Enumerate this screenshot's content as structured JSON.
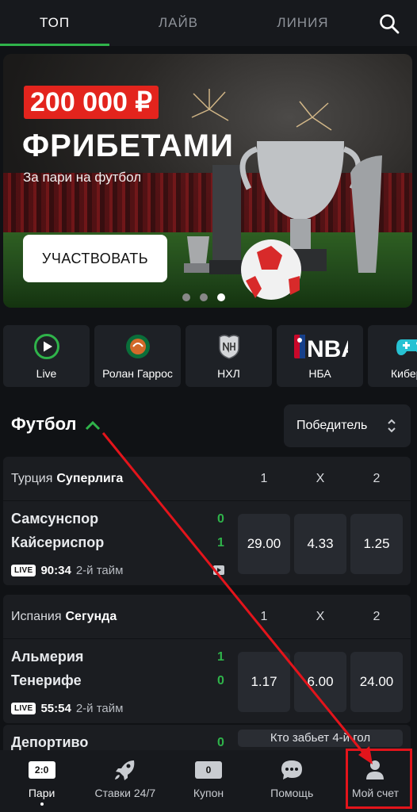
{
  "tabs": [
    {
      "label": "ТОП"
    },
    {
      "label": "ЛАЙВ"
    },
    {
      "label": "ЛИНИЯ"
    }
  ],
  "banner": {
    "amount": "200 000 ₽",
    "title": "ФРИБЕТАМИ",
    "subtitle": "За пари на футбол",
    "cta": "УЧАСТВОВАТЬ",
    "active_slide": 3,
    "slides": 3
  },
  "categories": [
    {
      "label": "Live",
      "icon": "play-circle-icon"
    },
    {
      "label": "Ролан Гаррос",
      "icon": "roland-garros-icon"
    },
    {
      "label": "НХЛ",
      "icon": "nhl-shield-icon"
    },
    {
      "label": "НБА",
      "icon": "nba-logo-icon",
      "logo_text": "NBA"
    },
    {
      "label": "Киберф",
      "icon": "gamepad-icon"
    }
  ],
  "section": {
    "title": "Футбол",
    "selector": "Победитель"
  },
  "columns": [
    "1",
    "X",
    "2"
  ],
  "matches": [
    {
      "country": "Турция",
      "league": "Суперлига",
      "home": "Самсунспор",
      "away": "Кайсериспор",
      "home_score": "0",
      "away_score": "1",
      "live_badge": "LIVE",
      "time": "90:34",
      "period": "2-й тайм",
      "odds": [
        "29.00",
        "4.33",
        "1.25"
      ]
    },
    {
      "country": "Испания",
      "league": "Сегунда",
      "home": "Альмерия",
      "away": "Тенерифе",
      "home_score": "1",
      "away_score": "0",
      "live_badge": "LIVE",
      "time": "55:54",
      "period": "2-й тайм",
      "odds": [
        "1.17",
        "6.00",
        "24.00"
      ]
    }
  ],
  "partial_match": {
    "home": "Депортиво",
    "home_score": "0",
    "market": "Кто забьет 4-й гол"
  },
  "bottom_nav": [
    {
      "label": "Пари",
      "icon_text": "2:0",
      "icon": "bet-slip-icon"
    },
    {
      "label": "Ставки 24/7",
      "icon": "rocket-icon"
    },
    {
      "label": "Купон",
      "icon_text": "0",
      "icon": "coupon-icon"
    },
    {
      "label": "Помощь",
      "icon": "chat-bubble-icon"
    },
    {
      "label": "Мой счет",
      "icon": "user-icon"
    }
  ],
  "colors": {
    "accent_green": "#2fb34a",
    "promo_red": "#e3241d",
    "annotation_red": "#e3141b"
  }
}
